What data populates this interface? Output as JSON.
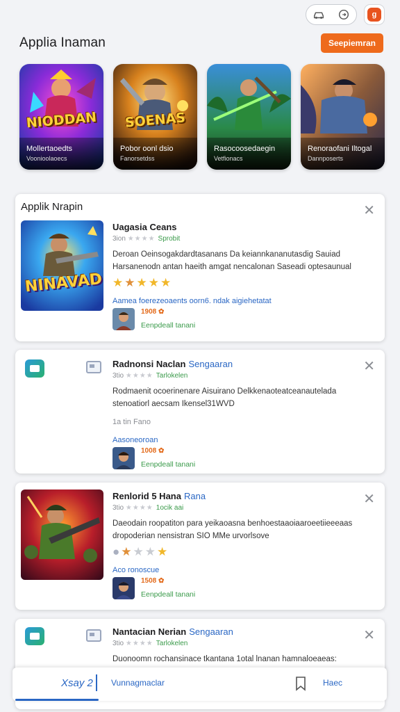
{
  "topbar": {
    "pill_icons": [
      "car-icon",
      "circle-arrow-icon"
    ],
    "profile_letter": "g"
  },
  "header": {
    "title": "Applia Inaman",
    "button_label": "Seepiemran"
  },
  "carousel": [
    {
      "logo": "NIODDAN",
      "name": "Mollertaoedts",
      "sub": "Voonioolaoecs"
    },
    {
      "logo": "SOENAS",
      "name": "Pobor oonl dsio",
      "sub": "Fanorsetdss"
    },
    {
      "logo": "",
      "name": "Rasocoosedaegin",
      "sub": "Vetfionacs"
    },
    {
      "logo": "",
      "name": "Renoraofani Iltogal",
      "sub": "Dannposerts"
    }
  ],
  "section": {
    "title": "Applik Nrapin"
  },
  "cards": [
    {
      "title": "Uagasia Ceans",
      "title_link": "",
      "rating_text": "3ion",
      "meta_green": "Sprobit",
      "desc": "Deroan  Oeinsogakdardtasanans Da keiannkananutasdig Sauiad Harsanenodn antan haeith amgat nencalonan Saseadi optesaunual",
      "link": "Aamea foerezeoaents oorn6. ndak aigiehetatat",
      "author_count": "1908",
      "author_status": "Eenpdeall tanani",
      "logo": "NINAVAD"
    },
    {
      "title": "Radnonsi Naclan",
      "title_link": "Sengaaran",
      "rating_text": "3tio",
      "meta_green": "Tarlokelen",
      "desc": "Rodmaenit  ocoerinenare Aisuirano Delkkenaoteatceanautelada stenoatiorl aecsam Ikensel31WVD",
      "link": "Aasoneoroan",
      "extra_line": "1a tin   Fano",
      "author_count": "1008",
      "author_status": "Eenpdeall tanani"
    },
    {
      "title": "Renlorid 5 Hana",
      "title_link": "Rana",
      "rating_text": "3tio",
      "meta_green": "1ocik aai",
      "desc": "Daeodain roopatiton para yeikaoasna benhoestaaoiaaroeetiieeeaas dropoderian nensistran SIO MMe   urvorlsove",
      "link": "Aco ronoscue",
      "author_count": "1508",
      "author_status": "Eenpdeall tanani"
    },
    {
      "title": "Nantacian Nerian",
      "title_link": "Sengaaran",
      "rating_text": "3tio",
      "meta_green": "Tarlokelen",
      "desc": "Duonoomn rochansinace tkantana 1otal  lnanan hamnaloeaeas:"
    }
  ],
  "bottombar": {
    "left": "Xsay 2",
    "mid": "Vunnagmaclar",
    "right": "Haec"
  }
}
